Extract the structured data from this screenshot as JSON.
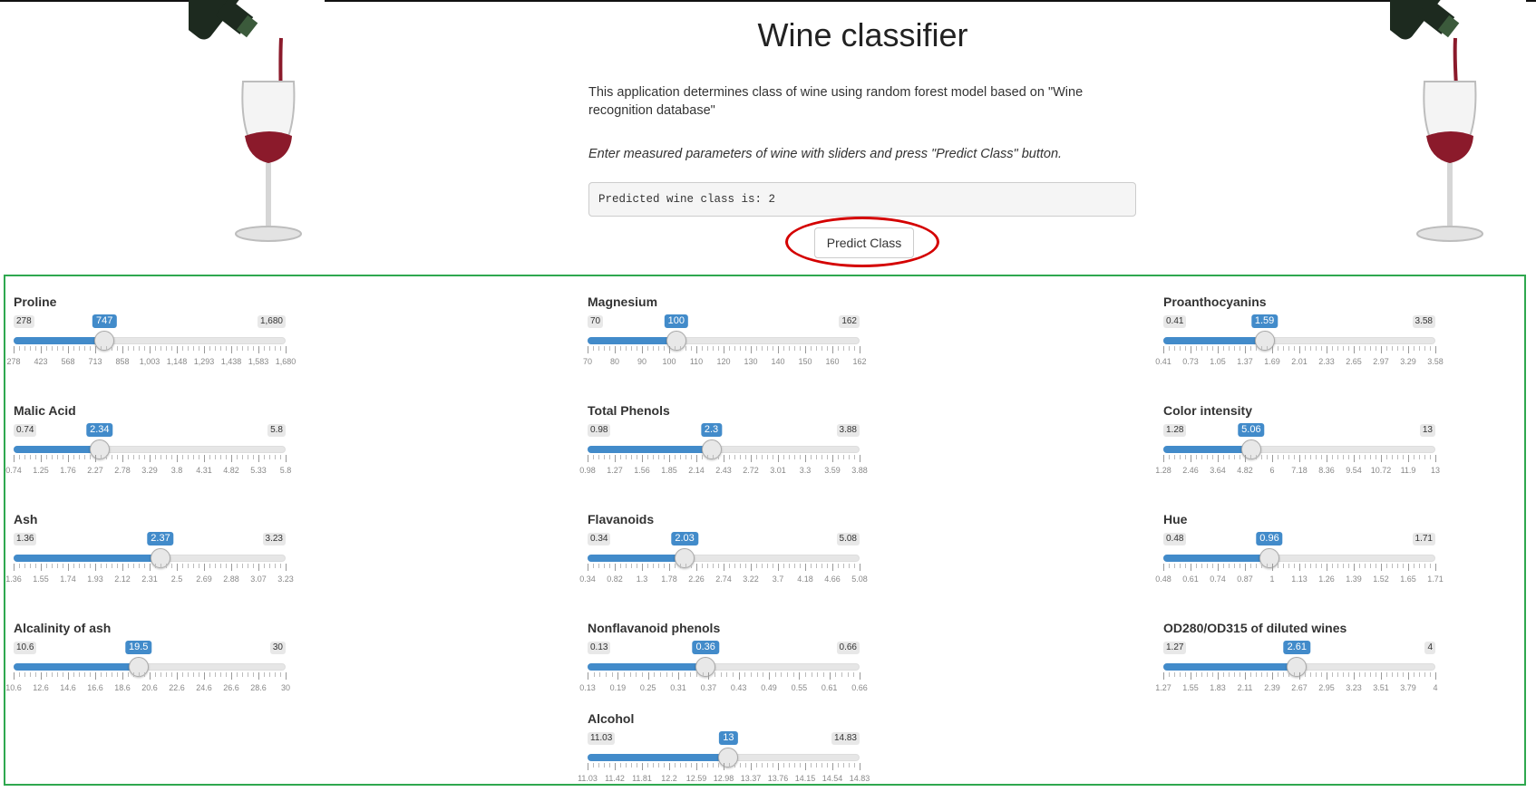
{
  "header": {
    "title": "Wine classifier",
    "description": "This application determines class of wine using random forest model based on \"Wine recognition database\"",
    "instructions": "Enter measured parameters of wine with sliders and press \"Predict Class\" button.",
    "output_text": "Predicted wine class is: 2",
    "predict_button": "Predict Class"
  },
  "colors": {
    "slider_accent": "#428bca",
    "highlight_ring": "#d40000",
    "panel_border": "#2fa84f",
    "wine_red": "#8b1a2b"
  },
  "sliders": [
    {
      "id": "proline",
      "label": "Proline",
      "min": "278",
      "max": "1,680",
      "value": "747",
      "fraction": 0.334,
      "ticks": [
        "278",
        "423",
        "568",
        "713",
        "858",
        "1,003",
        "1,148",
        "1,293",
        "1,438",
        "1,583",
        "1,680"
      ]
    },
    {
      "id": "malic",
      "label": "Malic Acid",
      "min": "0.74",
      "max": "5.8",
      "value": "2.34",
      "fraction": 0.316,
      "ticks": [
        "0.74",
        "1.25",
        "1.76",
        "2.27",
        "2.78",
        "3.29",
        "3.8",
        "4.31",
        "4.82",
        "5.33",
        "5.8"
      ]
    },
    {
      "id": "ash",
      "label": "Ash",
      "min": "1.36",
      "max": "3.23",
      "value": "2.37",
      "fraction": 0.54,
      "ticks": [
        "1.36",
        "1.55",
        "1.74",
        "1.93",
        "2.12",
        "2.31",
        "2.5",
        "2.69",
        "2.88",
        "3.07",
        "3.23"
      ]
    },
    {
      "id": "alcalinity",
      "label": "Alcalinity of ash",
      "min": "10.6",
      "max": "30",
      "value": "19.5",
      "fraction": 0.459,
      "ticks": [
        "10.6",
        "12.6",
        "14.6",
        "16.6",
        "18.6",
        "20.6",
        "22.6",
        "24.6",
        "26.6",
        "28.6",
        "30"
      ]
    },
    {
      "id": "magnesium",
      "label": "Magnesium",
      "min": "70",
      "max": "162",
      "value": "100",
      "fraction": 0.326,
      "ticks": [
        "70",
        "80",
        "90",
        "100",
        "110",
        "120",
        "130",
        "140",
        "150",
        "160",
        "162"
      ]
    },
    {
      "id": "phenols",
      "label": "Total Phenols",
      "min": "0.98",
      "max": "3.88",
      "value": "2.3",
      "fraction": 0.455,
      "ticks": [
        "0.98",
        "1.27",
        "1.56",
        "1.85",
        "2.14",
        "2.43",
        "2.72",
        "3.01",
        "3.3",
        "3.59",
        "3.88"
      ]
    },
    {
      "id": "flavanoids",
      "label": "Flavanoids",
      "min": "0.34",
      "max": "5.08",
      "value": "2.03",
      "fraction": 0.357,
      "ticks": [
        "0.34",
        "0.82",
        "1.3",
        "1.78",
        "2.26",
        "2.74",
        "3.22",
        "3.7",
        "4.18",
        "4.66",
        "5.08"
      ]
    },
    {
      "id": "nonflav",
      "label": "Nonflavanoid phenols",
      "min": "0.13",
      "max": "0.66",
      "value": "0.36",
      "fraction": 0.434,
      "ticks": [
        "0.13",
        "0.19",
        "0.25",
        "0.31",
        "0.37",
        "0.43",
        "0.49",
        "0.55",
        "0.61",
        "0.66"
      ]
    },
    {
      "id": "alcohol",
      "label": "Alcohol",
      "min": "11.03",
      "max": "14.83",
      "value": "13",
      "fraction": 0.518,
      "ticks": [
        "11.03",
        "11.42",
        "11.81",
        "12.2",
        "12.59",
        "12.98",
        "13.37",
        "13.76",
        "14.15",
        "14.54",
        "14.83"
      ]
    },
    {
      "id": "proanth",
      "label": "Proanthocyanins",
      "min": "0.41",
      "max": "3.58",
      "value": "1.59",
      "fraction": 0.372,
      "ticks": [
        "0.41",
        "0.73",
        "1.05",
        "1.37",
        "1.69",
        "2.01",
        "2.33",
        "2.65",
        "2.97",
        "3.29",
        "3.58"
      ]
    },
    {
      "id": "color",
      "label": "Color intensity",
      "min": "1.28",
      "max": "13",
      "value": "5.06",
      "fraction": 0.323,
      "ticks": [
        "1.28",
        "2.46",
        "3.64",
        "4.82",
        "6",
        "7.18",
        "8.36",
        "9.54",
        "10.72",
        "11.9",
        "13"
      ]
    },
    {
      "id": "hue",
      "label": "Hue",
      "min": "0.48",
      "max": "1.71",
      "value": "0.96",
      "fraction": 0.39,
      "ticks": [
        "0.48",
        "0.61",
        "0.74",
        "0.87",
        "1",
        "1.13",
        "1.26",
        "1.39",
        "1.52",
        "1.65",
        "1.71"
      ]
    },
    {
      "id": "od280",
      "label": "OD280/OD315 of diluted wines",
      "min": "1.27",
      "max": "4",
      "value": "2.61",
      "fraction": 0.491,
      "ticks": [
        "1.27",
        "1.55",
        "1.83",
        "2.11",
        "2.39",
        "2.67",
        "2.95",
        "3.23",
        "3.51",
        "3.79",
        "4"
      ]
    }
  ]
}
